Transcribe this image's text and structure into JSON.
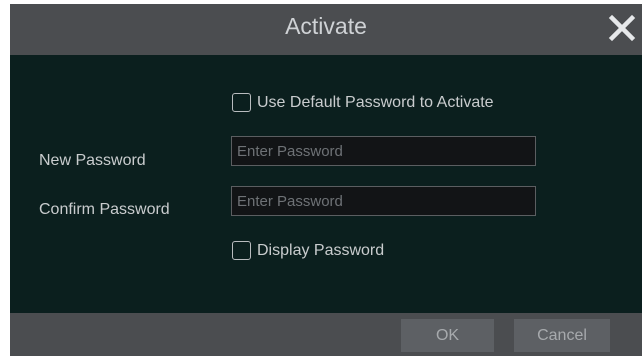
{
  "dialog": {
    "title": "Activate",
    "close_icon": "close-icon"
  },
  "form": {
    "use_default_label": "Use Default Password to Activate",
    "use_default_checked": false,
    "new_password_label": "New Password",
    "new_password_placeholder": "Enter Password",
    "new_password_value": "",
    "confirm_password_label": "Confirm Password",
    "confirm_password_placeholder": "Enter Password",
    "confirm_password_value": "",
    "display_password_label": "Display Password",
    "display_password_checked": false
  },
  "footer": {
    "ok_label": "OK",
    "cancel_label": "Cancel"
  },
  "colors": {
    "titlebar": "#4b4d50",
    "body": "#0b1f1e",
    "text": "#c9ccce"
  }
}
